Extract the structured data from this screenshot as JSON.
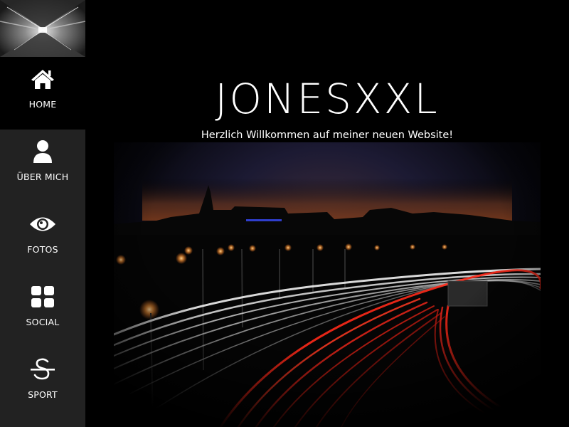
{
  "site": {
    "title": "JONESXXL",
    "welcome": "Herzlich Willkommen auf meiner neuen Website!"
  },
  "nav": {
    "items": [
      {
        "label": "HOME",
        "icon": "home-icon",
        "active": true
      },
      {
        "label": "ÜBER MICH",
        "icon": "user-icon",
        "active": false
      },
      {
        "label": "FOTOS",
        "icon": "eye-icon",
        "active": false
      },
      {
        "label": "SOCIAL",
        "icon": "grid-icon",
        "active": false
      },
      {
        "label": "SPORT",
        "icon": "strike-s-icon",
        "active": false
      }
    ]
  },
  "colors": {
    "sidebar_bg": "#222222",
    "active_bg": "#000000",
    "page_bg": "#000000",
    "text": "#ffffff"
  }
}
